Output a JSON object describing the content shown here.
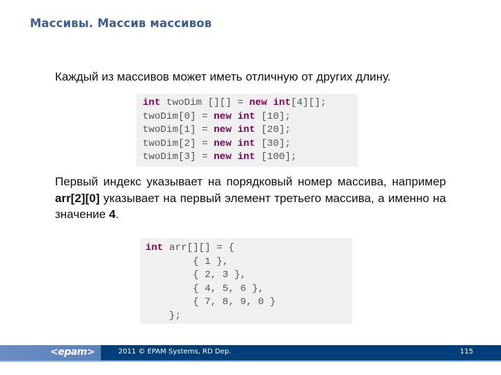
{
  "slide": {
    "title": "Массивы. Массив массивов",
    "intro": "Каждый из массивов может иметь отличную от других длину.",
    "code1": [
      [
        {
          "t": "int",
          "kw": true
        },
        {
          "t": " twoDim [][] = ",
          "kw": false
        },
        {
          "t": "new",
          "kw": true
        },
        {
          "t": " ",
          "kw": false
        },
        {
          "t": "int",
          "kw": true
        },
        {
          "t": "[4][];",
          "kw": false
        }
      ],
      [
        {
          "t": "twoDim[0] = ",
          "kw": false
        },
        {
          "t": "new",
          "kw": true
        },
        {
          "t": " ",
          "kw": false
        },
        {
          "t": "int",
          "kw": true
        },
        {
          "t": " [10];",
          "kw": false
        }
      ],
      [
        {
          "t": "twoDim[1] = ",
          "kw": false
        },
        {
          "t": "new",
          "kw": true
        },
        {
          "t": " ",
          "kw": false
        },
        {
          "t": "int",
          "kw": true
        },
        {
          "t": " [20];",
          "kw": false
        }
      ],
      [
        {
          "t": "twoDim[2] = ",
          "kw": false
        },
        {
          "t": "new",
          "kw": true
        },
        {
          "t": " ",
          "kw": false
        },
        {
          "t": "int",
          "kw": true
        },
        {
          "t": " [30];",
          "kw": false
        }
      ],
      [
        {
          "t": "twoDim[3] = ",
          "kw": false
        },
        {
          "t": "new",
          "kw": true
        },
        {
          "t": " ",
          "kw": false
        },
        {
          "t": "int",
          "kw": true
        },
        {
          "t": " [100];",
          "kw": false
        }
      ]
    ],
    "para": {
      "part1": "Первый индекс указывает на порядковый номер массива, например ",
      "bold1": "arr[2][0]",
      "part2": " указывает на первый элемент третьего массива, а именно на значение ",
      "bold2": "4",
      "part3": "."
    },
    "code2": [
      [
        {
          "t": "int",
          "kw": true
        },
        {
          "t": " arr[][] = {",
          "kw": false
        }
      ],
      [
        {
          "t": "        { 1 },",
          "kw": false
        }
      ],
      [
        {
          "t": "        { 2, 3 },",
          "kw": false
        }
      ],
      [
        {
          "t": "        { 4, 5, 6 },",
          "kw": false
        }
      ],
      [
        {
          "t": "        { 7, 8, 9, 0 }",
          "kw": false
        }
      ],
      [
        {
          "t": "    };",
          "kw": false
        }
      ]
    ]
  },
  "footer": {
    "logo": "<epam>",
    "copyright": "2011 © EPAM Systems, RD Dep.",
    "page_number": "115"
  },
  "colors": {
    "title": "#3b5f8e",
    "keyword": "#7f0055",
    "footer_bg": "#003f7a",
    "footer_left": "#6a8dc4",
    "code_bg": "#f0f0f0"
  }
}
